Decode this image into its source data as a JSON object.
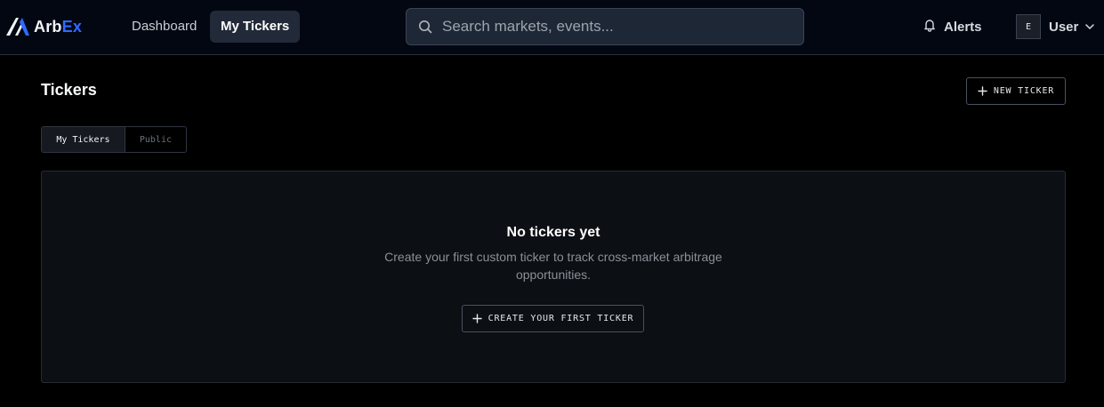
{
  "app": {
    "logo_part1": "Arb",
    "logo_part2": "Ex",
    "brand_color": "#2f6bff"
  },
  "nav": {
    "items": [
      {
        "label": "Dashboard",
        "active": false
      },
      {
        "label": "My Tickers",
        "active": true
      }
    ]
  },
  "search": {
    "placeholder": "Search markets, events...",
    "icon": "search-icon"
  },
  "header_actions": {
    "alerts_label": "Alerts",
    "alerts_icon": "bell-icon",
    "user_initial": "E",
    "user_label": "User",
    "user_menu_icon": "chevron-down-icon"
  },
  "page": {
    "title": "Tickers",
    "new_button_label": "NEW TICKER",
    "tabs": [
      {
        "label": "My Tickers",
        "active": true
      },
      {
        "label": "Public",
        "active": false
      }
    ]
  },
  "empty_state": {
    "title": "No tickers yet",
    "description": "Create your first custom ticker to track cross-market arbitrage opportunities.",
    "button_label": "CREATE YOUR FIRST TICKER"
  }
}
